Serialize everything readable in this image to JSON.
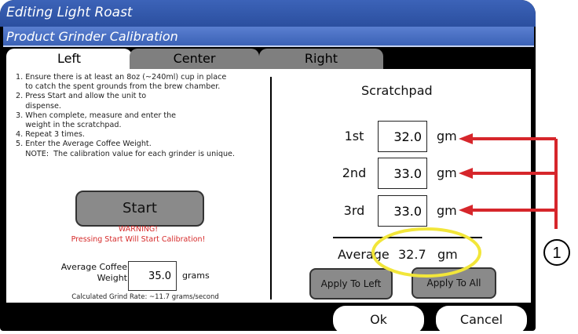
{
  "window": {
    "title": "Editing Light Roast",
    "subtitle": "Product Grinder Calibration"
  },
  "tabs": [
    {
      "label": "Left",
      "active": true
    },
    {
      "label": "Center",
      "active": false
    },
    {
      "label": "Right",
      "active": false
    }
  ],
  "left_panel": {
    "instructions": "1. Ensure there is at least an 8oz (~240ml) cup in place\n    to catch the spent grounds from the brew chamber.\n2. Press Start and allow the unit to\n    dispense.\n3. When complete, measure and enter the\n    weight in the scratchpad.\n4. Repeat 3 times.\n5. Enter the Average Coffee Weight.\n    NOTE:  The calibration value for each grinder is unique.",
    "start_label": "Start",
    "warning_line1": "WARNING!",
    "warning_line2": "Pressing Start Will Start Calibration!",
    "avg_label": "Average Coffee\nWeight",
    "avg_value": "35.0",
    "avg_unit": "grams",
    "calc_rate": "Calculated Grind Rate: ~11.7 grams/second"
  },
  "scratchpad": {
    "title": "Scratchpad",
    "rows": [
      {
        "label": "1st",
        "value": "32.0",
        "unit": "gm"
      },
      {
        "label": "2nd",
        "value": "33.0",
        "unit": "gm"
      },
      {
        "label": "3rd",
        "value": "33.0",
        "unit": "gm"
      }
    ],
    "average_label": "Average",
    "average_value": "32.7",
    "average_unit": "gm",
    "apply_left_label": "Apply To Left",
    "apply_all_label": "Apply To All"
  },
  "footer": {
    "ok_label": "Ok",
    "cancel_label": "Cancel"
  },
  "annotation": {
    "callout_number": "1",
    "arrow_color": "#d6262b",
    "highlight_color": "#f2e63a"
  }
}
